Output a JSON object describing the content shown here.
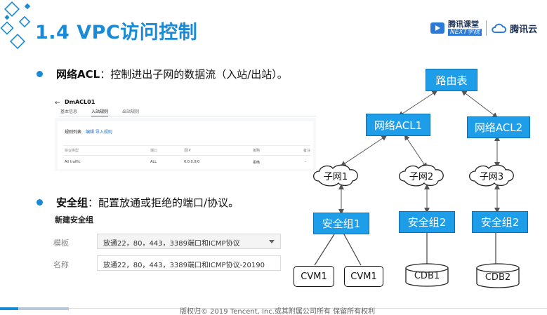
{
  "slide": {
    "title": "1.4 VPC访问控制"
  },
  "brand": {
    "logo_line1": "腾讯课堂",
    "logo_line2": "NEXT学院",
    "cloud_name": "腾讯云",
    "accent": "#1a8ad6"
  },
  "bullets": [
    {
      "head": "网络ACL",
      "text": "：控制进出子网的数据流（入站/出站）。"
    },
    {
      "head": "安全组",
      "text": "：配置放通或拒绝的端口/协议。"
    }
  ],
  "acl_console": {
    "back_icon": "arrow-left-icon",
    "title": "DmACL01",
    "tabs": [
      "基本信息",
      "入站规则",
      "出站规则"
    ],
    "active_tab": "入站规则",
    "rule_list_title": "规则列表",
    "rule_list_links": "编辑  导入规则",
    "columns": [
      "协议类型",
      "端口",
      "源IP",
      "策略",
      "备注"
    ],
    "rows": [
      [
        "All traffic",
        "ALL",
        "0.0.0.0/0",
        "拒绝",
        "-"
      ]
    ]
  },
  "sg_form": {
    "title": "新建安全组",
    "template_label": "模板",
    "template_value": "放通22，80，443，3389端口和ICMP协议",
    "name_label": "名称",
    "name_value": "放通22，80，443，3389端口和ICMP协议-20190"
  },
  "diagram": {
    "route_table": "路由表",
    "acls": [
      "网络ACL1",
      "网络ACL2"
    ],
    "subnets": [
      "子网1",
      "子网2",
      "子网3"
    ],
    "security_groups": [
      "安全组1",
      "安全组2",
      "安全组2"
    ],
    "instances": [
      "CVM1",
      "CVM1",
      "CDB1",
      "CDB2"
    ]
  },
  "footer": {
    "copyright": "版权归© 2019 Tencent, Inc.或其附属公司所有 保留所有权利"
  }
}
